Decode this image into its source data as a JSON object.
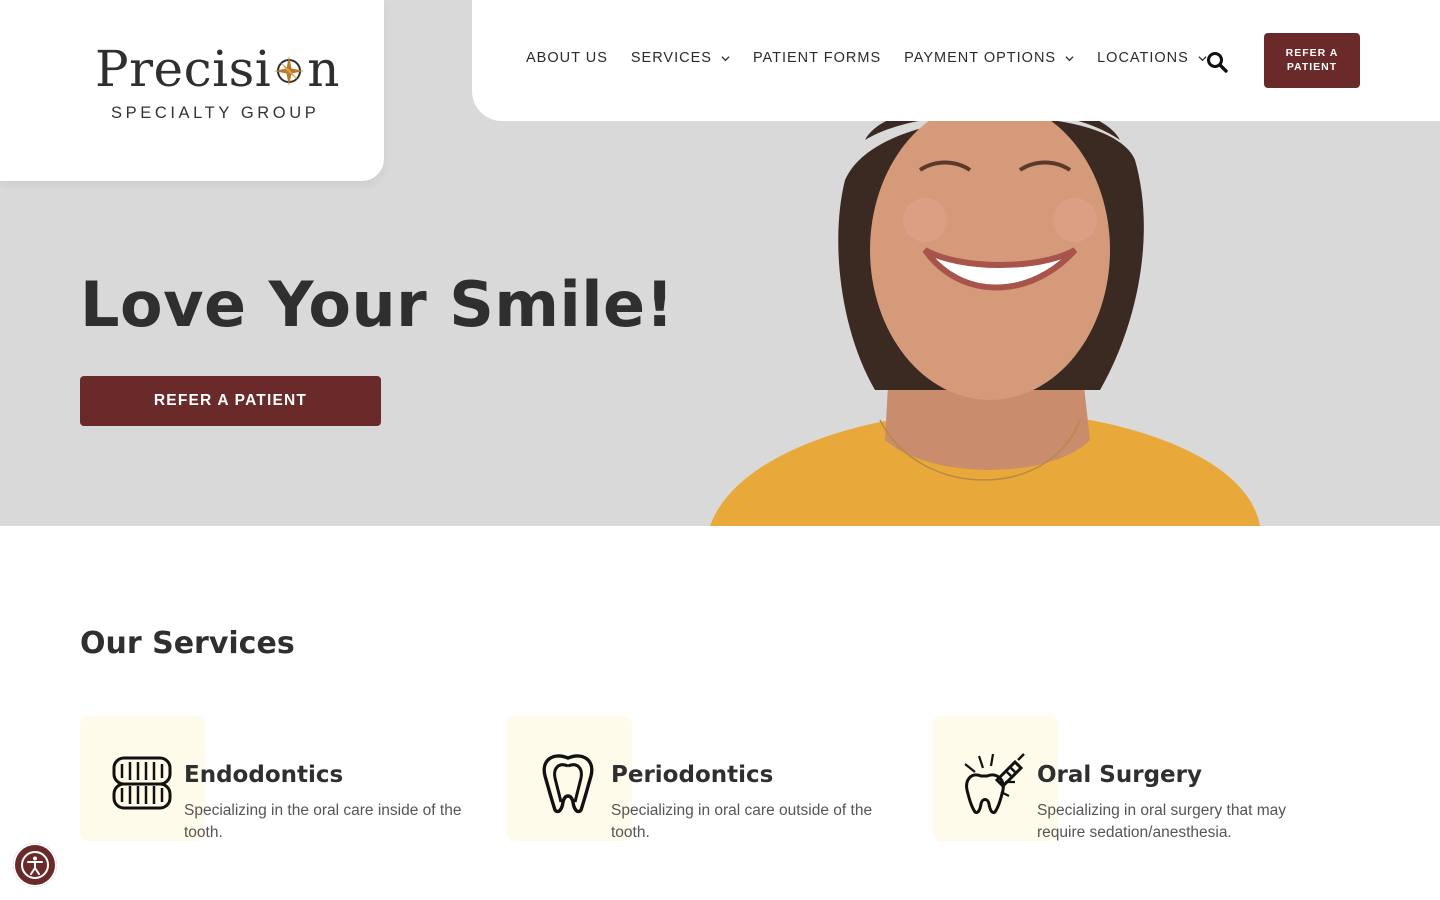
{
  "brand": {
    "name_part1": "Precisi",
    "name_part2": "n",
    "tagline": "SPECIALTY GROUP",
    "accent": "#b87a2a"
  },
  "nav": {
    "items": [
      {
        "label": "ABOUT US",
        "dropdown": false
      },
      {
        "label": "SERVICES",
        "dropdown": true
      },
      {
        "label": "PATIENT FORMS",
        "dropdown": false
      },
      {
        "label": "PAYMENT OPTIONS",
        "dropdown": true
      },
      {
        "label": "LOCATIONS",
        "dropdown": true
      }
    ],
    "search_icon": "search-icon",
    "refer_label": "REFER A PATIENT"
  },
  "hero": {
    "title": "Love Your Smile!",
    "cta_label": "REFER A PATIENT",
    "background": "#d9d9d9"
  },
  "services": {
    "title": "Our Services",
    "items": [
      {
        "name": "Endodontics",
        "description": "Specializing in the oral care inside of the tooth.",
        "icon": "dentures-icon"
      },
      {
        "name": "Periodontics",
        "description": "Specializing in oral care outside of the tooth.",
        "icon": "tooth-root-icon"
      },
      {
        "name": "Oral Surgery",
        "description": "Specializing in oral surgery that may require sedation/anesthesia.",
        "icon": "tooth-syringe-icon"
      }
    ]
  },
  "colors": {
    "primary": "#6a2a2a",
    "text": "#2f2f2f",
    "service_tile": "#fffbea"
  },
  "accessibility": {
    "icon": "accessibility-icon"
  }
}
